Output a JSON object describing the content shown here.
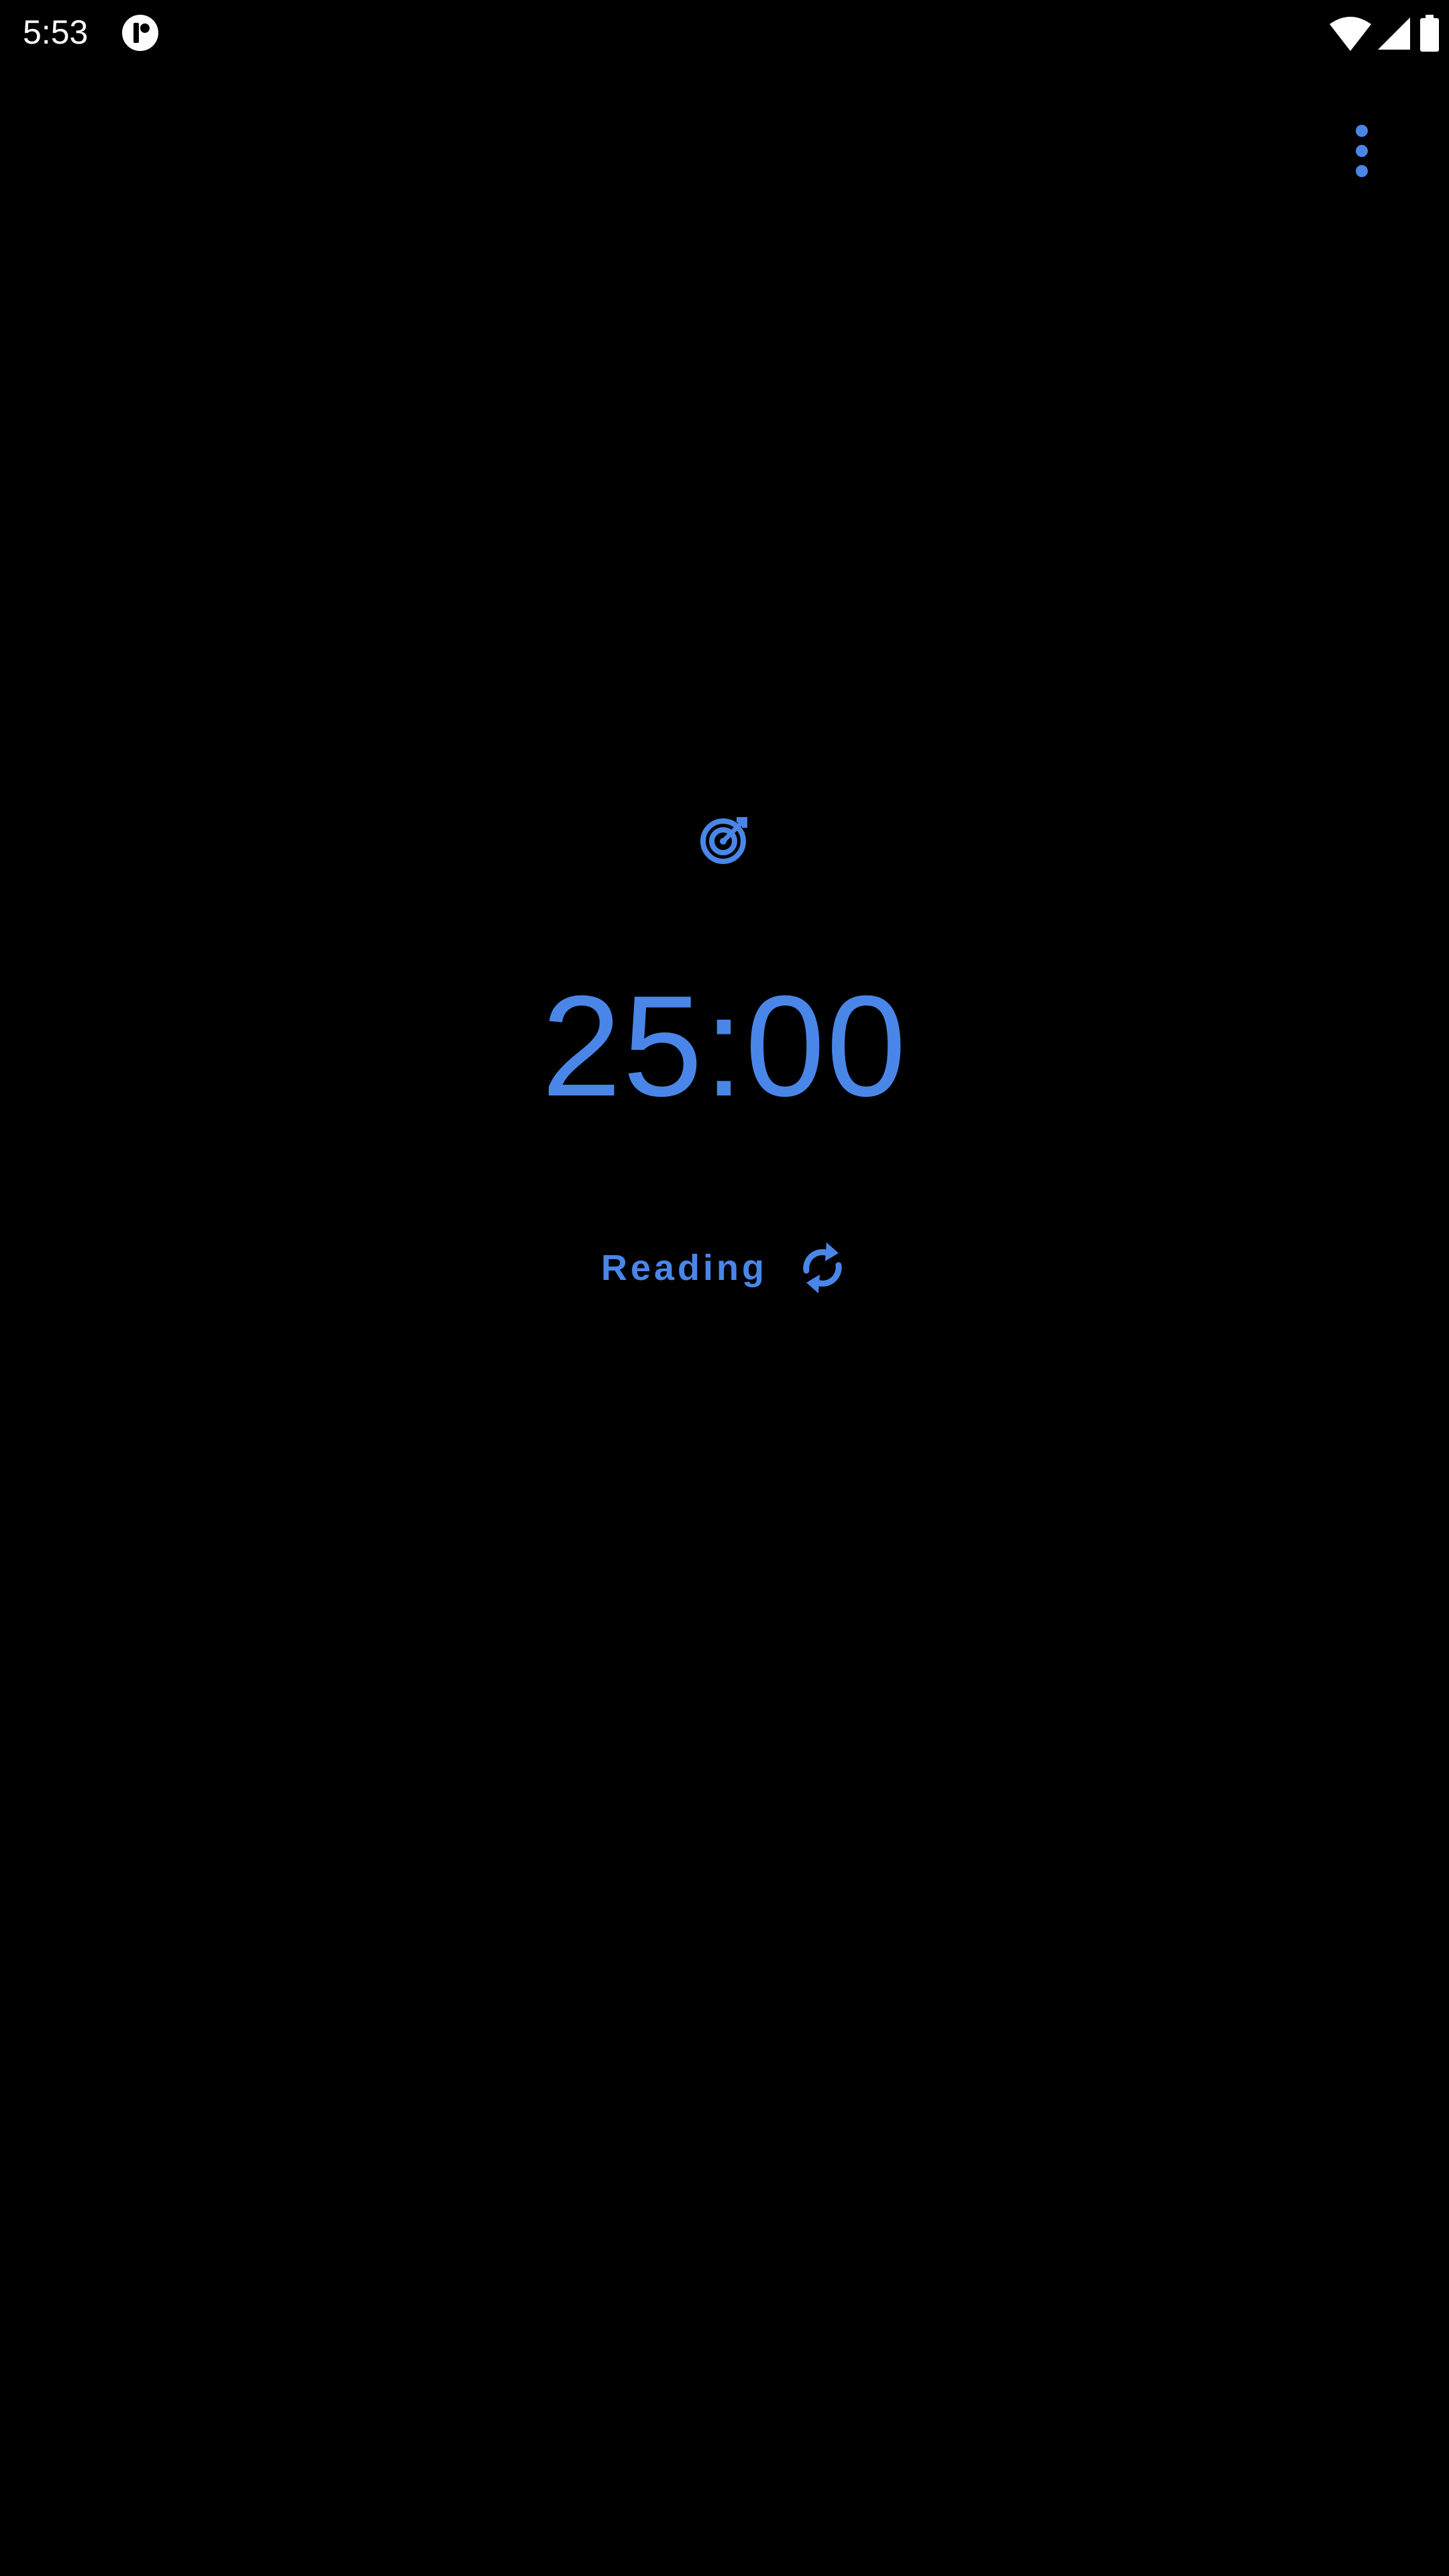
{
  "status_bar": {
    "time": "5:53",
    "icons": [
      "app-notification-icon",
      "wifi-icon",
      "signal-icon",
      "battery-icon"
    ]
  },
  "toolbar": {
    "overflow_icon": "more-vert-icon"
  },
  "timer": {
    "goal_icon": "target-icon",
    "display": "25:00",
    "label": "Reading",
    "label_action_icon": "cycle-icon"
  },
  "colors": {
    "background": "#000000",
    "accent": "#4a86e8",
    "status_text": "#ffffff"
  }
}
